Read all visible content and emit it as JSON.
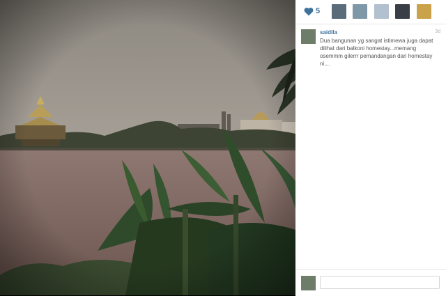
{
  "photo": {
    "alt": ""
  },
  "likes": {
    "count": "5",
    "icon": "heart-icon",
    "color": "#3f729b",
    "likers": [
      {
        "icon": "user-avatar",
        "color": "#5a6b7a"
      },
      {
        "icon": "user-avatar",
        "color": "#7f98a8"
      },
      {
        "icon": "user-avatar",
        "color": "#b3c0d0"
      },
      {
        "icon": "user-avatar",
        "color": "#3a3f47"
      },
      {
        "icon": "user-avatar",
        "color": "#c9a24a"
      }
    ]
  },
  "comment": {
    "username": "saidila",
    "time": "3d",
    "text": "Dua bangunan yg sangat istimewa juga dapat dilihat dari balkoni homestay...memang osemmm gilerrr pemandangan dari homestay ni....",
    "avatar_color": "#6e7d6a"
  },
  "footer": {
    "placeholder": "",
    "avatar_color": "#6e7d6a"
  }
}
